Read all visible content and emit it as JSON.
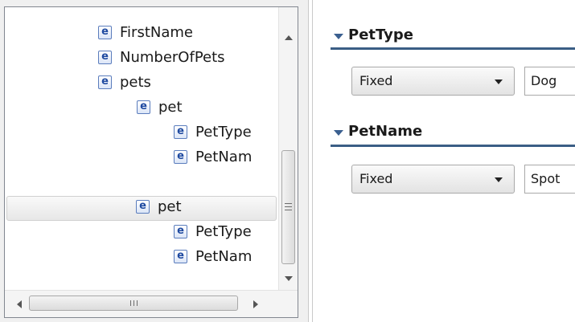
{
  "tree": {
    "icon_letter": "e",
    "nodes": [
      {
        "label": "FirstName",
        "indent": 1,
        "selected": false
      },
      {
        "label": "NumberOfPets",
        "indent": 1,
        "selected": false
      },
      {
        "label": "pets",
        "indent": 1,
        "selected": false
      },
      {
        "label": "pet",
        "indent": 2,
        "selected": false
      },
      {
        "label": "PetType",
        "indent": 3,
        "selected": false
      },
      {
        "label": "PetNam",
        "indent": 3,
        "selected": false
      },
      {
        "label": "pet",
        "indent": 2,
        "selected": true
      },
      {
        "label": "PetType",
        "indent": 3,
        "selected": false
      },
      {
        "label": "PetNam",
        "indent": 3,
        "selected": false
      }
    ]
  },
  "sections": [
    {
      "title": "PetType",
      "mode": "Fixed",
      "value": "Dog"
    },
    {
      "title": "PetName",
      "mode": "Fixed",
      "value": "Spot"
    }
  ],
  "colors": {
    "icon_border": "#5b7dbd",
    "section_rule": "#3b5e85",
    "toggle": "#3a5f8f"
  }
}
